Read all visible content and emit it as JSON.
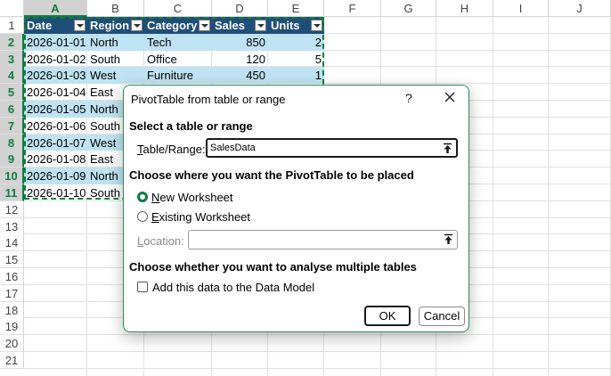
{
  "sheet": {
    "columns": [
      "A",
      "B",
      "C",
      "D",
      "E",
      "F",
      "G",
      "H",
      "I",
      "J"
    ],
    "selected_column": "A",
    "rows": [
      "1",
      "2",
      "3",
      "4",
      "5",
      "6",
      "7",
      "8",
      "9",
      "10",
      "11",
      "12",
      "13",
      "14",
      "15",
      "16",
      "17",
      "18",
      "19",
      "20",
      "21"
    ],
    "selected_rows": [
      "2",
      "3",
      "4",
      "5",
      "6",
      "7",
      "8",
      "9",
      "10",
      "11"
    ],
    "table_headers": [
      "Date",
      "Region",
      "Category",
      "Sales",
      "Units"
    ],
    "table_rows": [
      [
        "2026-01-01",
        "North",
        "Tech",
        "850",
        "2"
      ],
      [
        "2026-01-02",
        "South",
        "Office",
        "120",
        "5"
      ],
      [
        "2026-01-03",
        "West",
        "Furniture",
        "450",
        "1"
      ],
      [
        "2026-01-04",
        "East",
        "",
        "",
        ""
      ],
      [
        "2026-01-05",
        "North",
        "",
        "",
        ""
      ],
      [
        "2026-01-06",
        "South",
        "",
        "",
        ""
      ],
      [
        "2026-01-07",
        "West",
        "",
        "",
        ""
      ],
      [
        "2026-01-08",
        "East",
        "",
        "",
        ""
      ],
      [
        "2026-01-09",
        "North",
        "",
        "",
        ""
      ],
      [
        "2026-01-10",
        "South",
        "",
        "",
        ""
      ]
    ],
    "colors": {
      "header": "#1f4e78",
      "band": "#bfe3f2",
      "accent": "#107c41"
    }
  },
  "dialog": {
    "title": "PivotTable from table or range",
    "help": "?",
    "close_icon": "close-icon",
    "section_select": "Select a table or range",
    "table_range_label_accel": "T",
    "table_range_label_rest": "able/Range:",
    "table_range_value": "SalesData",
    "section_placement": "Choose where you want the PivotTable to be placed",
    "new_worksheet_accel": "N",
    "new_worksheet_rest": "ew Worksheet",
    "existing_worksheet_accel": "E",
    "existing_worksheet_rest": "xisting Worksheet",
    "location_accel": "L",
    "location_rest": "ocation:",
    "location_value": "",
    "section_multiple": "Choose whether you want to analyse multiple tables",
    "data_model_label": "Add this data to the Data Model",
    "data_model_checked": false,
    "placement_selected": "new_worksheet",
    "ok_label": "OK",
    "cancel_label": "Cancel",
    "picker_icon": "range-picker-icon"
  }
}
